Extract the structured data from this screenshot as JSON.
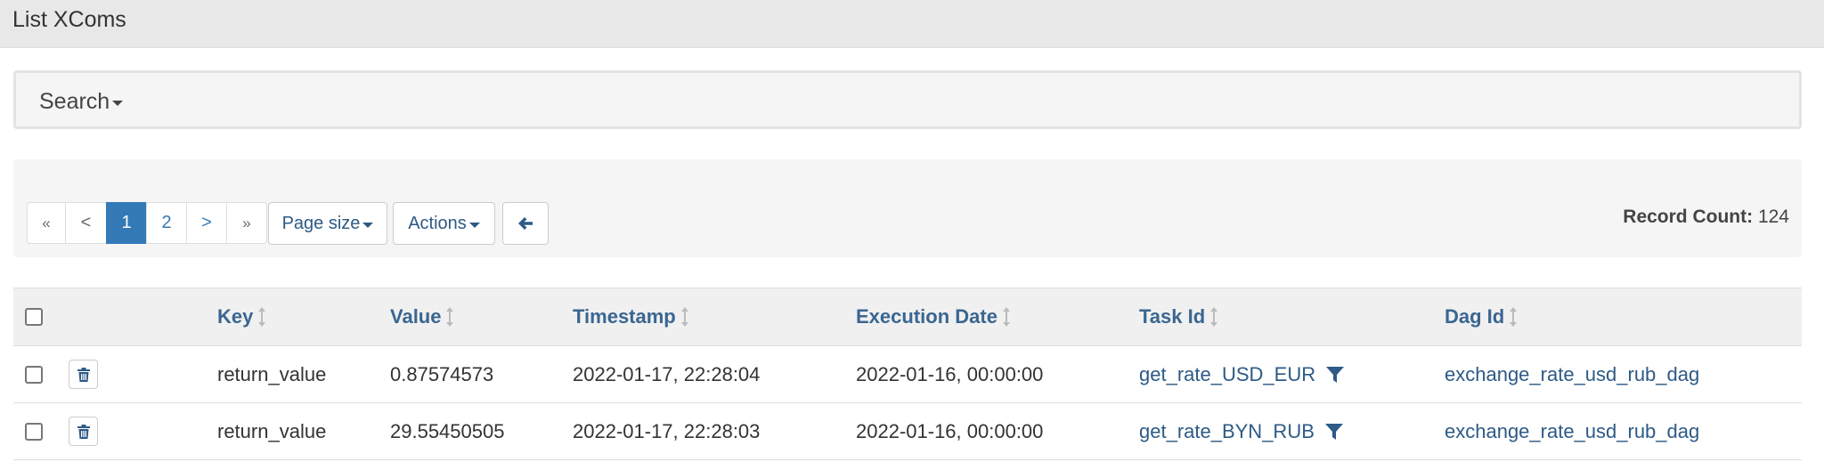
{
  "page": {
    "title": "List XComs"
  },
  "search": {
    "label": "Search"
  },
  "pagination": {
    "first": "«",
    "prev": "<",
    "pages": [
      "1",
      "2"
    ],
    "active_page": "1",
    "next": ">",
    "last": "»"
  },
  "toolbar": {
    "page_size_label": "Page size",
    "actions_label": "Actions",
    "back_icon": "arrow-left-icon"
  },
  "record_count": {
    "label": "Record Count:",
    "value": "124"
  },
  "table": {
    "columns": [
      "Key",
      "Value",
      "Timestamp",
      "Execution Date",
      "Task Id",
      "Dag Id"
    ],
    "rows": [
      {
        "key": "return_value",
        "value": "0.87574573",
        "timestamp": "2022-01-17, 22:28:04",
        "execution_date": "2022-01-16, 00:00:00",
        "task_id": "get_rate_USD_EUR",
        "dag_id": "exchange_rate_usd_rub_dag"
      },
      {
        "key": "return_value",
        "value": "29.55450505",
        "timestamp": "2022-01-17, 22:28:03",
        "execution_date": "2022-01-16, 00:00:00",
        "task_id": "get_rate_BYN_RUB",
        "dag_id": "exchange_rate_usd_rub_dag"
      }
    ]
  },
  "colors": {
    "accent": "#337ab7",
    "link": "#2d5a86",
    "header_bg": "#f0f0f0",
    "panel_bg": "#f5f5f5"
  },
  "icons": {
    "sort": "sort-icon",
    "delete": "trash-icon",
    "filter": "filter-icon",
    "search_caret": "caret-down-icon"
  }
}
